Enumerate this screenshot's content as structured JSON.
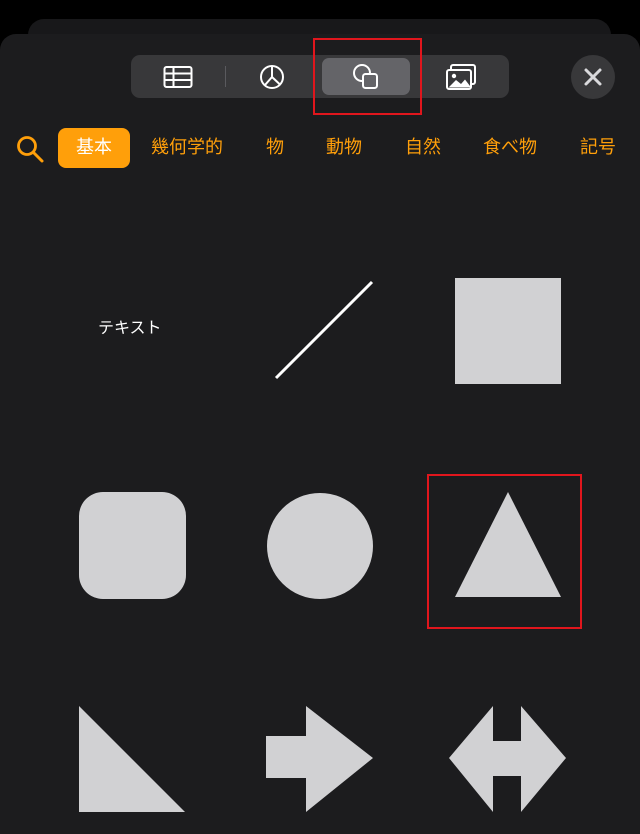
{
  "toolbar": {
    "tabs": [
      {
        "name": "table",
        "icon": "table-icon",
        "selected": false
      },
      {
        "name": "chart",
        "icon": "pie-chart-icon",
        "selected": false
      },
      {
        "name": "shape",
        "icon": "shapes-icon",
        "selected": true
      },
      {
        "name": "media",
        "icon": "photo-icon",
        "selected": false
      }
    ],
    "close_icon": "close-icon"
  },
  "categories": {
    "search_icon": "search-icon",
    "items": [
      {
        "label": "基本",
        "active": true
      },
      {
        "label": "幾何学的",
        "active": false
      },
      {
        "label": "物",
        "active": false
      },
      {
        "label": "動物",
        "active": false
      },
      {
        "label": "自然",
        "active": false
      },
      {
        "label": "食べ物",
        "active": false
      },
      {
        "label": "記号",
        "active": false
      }
    ]
  },
  "shapes": {
    "text_label": "テキスト",
    "items": [
      "text",
      "line",
      "square",
      "rounded-square",
      "circle",
      "triangle",
      "right-triangle",
      "arrow",
      "double-arrow"
    ]
  },
  "colors": {
    "accent": "#ff9f0a",
    "shape_fill": "#d1d1d3",
    "highlight": "#e0161d",
    "background": "#1c1c1e"
  }
}
